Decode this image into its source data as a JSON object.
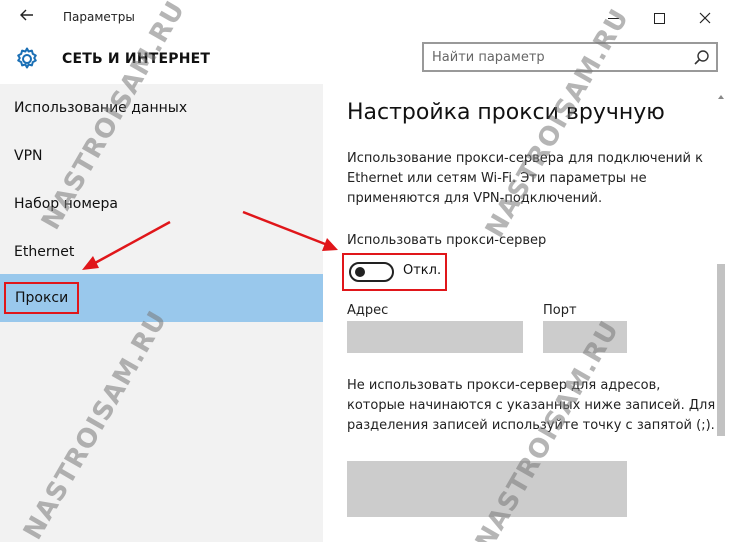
{
  "window": {
    "title": "Параметры"
  },
  "header": {
    "section_title": "СЕТЬ И ИНТЕРНЕТ",
    "search_placeholder": "Найти параметр"
  },
  "nav": {
    "items": [
      {
        "label": "Использование данных"
      },
      {
        "label": "VPN"
      },
      {
        "label": "Набор номера"
      },
      {
        "label": "Ethernet"
      },
      {
        "label": "Прокси"
      }
    ],
    "active_index": 4
  },
  "content": {
    "title": "Настройка прокси вручную",
    "description": "Использование прокси-сервера для подключений к Ethernet или сетям Wi-Fi. Эти параметры не применяются для VPN-подключений.",
    "use_proxy_label": "Использовать прокси-сервер",
    "toggle_state": "Откл.",
    "address_label": "Адрес",
    "port_label": "Порт",
    "address_value": "",
    "port_value": "",
    "exceptions_description": "Не использовать прокси-сервер для адресов, которые начинаются с указанных ниже записей. Для разделения записей используйте точку с запятой (;).",
    "exceptions_value": ""
  },
  "watermark": "NASTROISAM.RU",
  "colors": {
    "accent_selection": "#99c8ec",
    "annotation_red": "#e0161a",
    "nav_background": "#f2f2f2",
    "field_background": "#cccccc"
  }
}
